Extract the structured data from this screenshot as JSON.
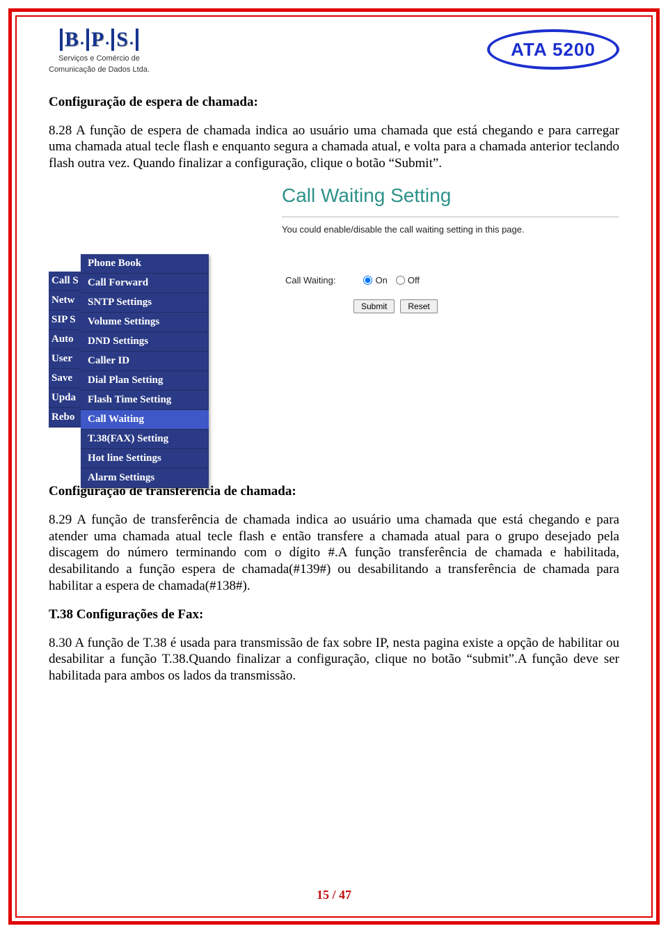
{
  "logo": {
    "sub1": "Serviços e Comércio de",
    "sub2": "Comunicação de Dados Ltda."
  },
  "badge": "ATA 5200",
  "section1": {
    "heading": "Configuração de espera de chamada:",
    "para": "8.28 A função de espera de chamada indica ao usuário uma chamada que está chegando e para carregar uma chamada atual tecle flash e enquanto segura a chamada atual, e volta para a chamada anterior teclando flash outra vez. Quando finalizar a configuração, clique o botão “Submit”."
  },
  "ui": {
    "title": "Call Waiting Setting",
    "desc": "You could enable/disable the call waiting setting in this page.",
    "nav_back": [
      "Call S",
      "Netw",
      "SIP S",
      "Auto",
      "User",
      "Save",
      "Upda",
      "Rebo"
    ],
    "nav_front": [
      {
        "label": "Phone Book",
        "sel": false
      },
      {
        "label": "Call Forward",
        "sel": false
      },
      {
        "label": "SNTP Settings",
        "sel": false
      },
      {
        "label": "Volume Settings",
        "sel": false
      },
      {
        "label": "DND Settings",
        "sel": false
      },
      {
        "label": "Caller ID",
        "sel": false
      },
      {
        "label": "Dial Plan Setting",
        "sel": false
      },
      {
        "label": "Flash Time Setting",
        "sel": false
      },
      {
        "label": "Call Waiting",
        "sel": true
      },
      {
        "label": "T.38(FAX) Setting",
        "sel": false
      },
      {
        "label": "Hot line Settings",
        "sel": false
      },
      {
        "label": "Alarm Settings",
        "sel": false
      }
    ],
    "form": {
      "label": "Call Waiting:",
      "on": "On",
      "off": "Off",
      "submit": "Submit",
      "reset": "Reset"
    }
  },
  "section2": {
    "heading": "Configuração de transferência de chamada:",
    "para": "8.29 A função de transferência de chamada indica ao usuário uma chamada que está chegando e para atender uma chamada atual tecle flash e então transfere a chamada atual para o grupo desejado pela discagem do número terminando com o dígito #.A função transferência de chamada e habilitada, desabilitando a função espera de chamada(#139#) ou desabilitando a transferência de chamada para habilitar a espera de chamada(#138#)."
  },
  "section3": {
    "heading": "T.38 Configurações de Fax:",
    "para": "8.30 A função de T.38 é usada para transmissão de fax sobre IP, nesta pagina existe a opção de habilitar ou desabilitar a função T.38.Quando finalizar a configuração, clique no botão “submit”.A função deve ser habilitada para ambos os lados da transmissão."
  },
  "pagenum": "15 / 47"
}
